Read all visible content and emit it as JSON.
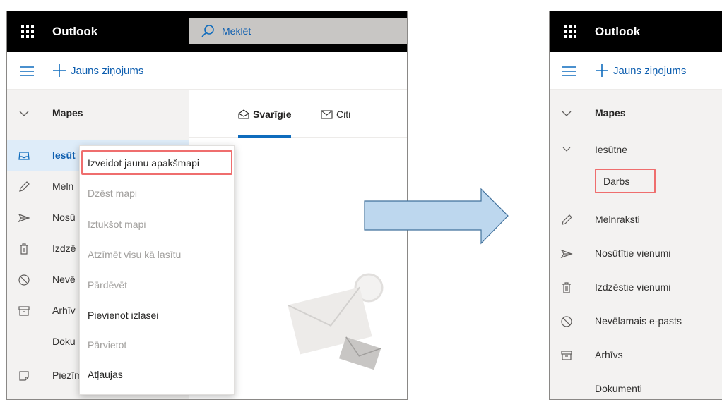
{
  "left": {
    "app_title": "Outlook",
    "search_placeholder": "Meklēt",
    "new_message": "Jauns ziņojums",
    "folders_header": "Mapes",
    "folders": [
      "Iesūt",
      "Meln",
      "Nosū",
      "Izdzē",
      "Nevē",
      "Arhīv",
      "Doku",
      "Piezīmes"
    ],
    "tabs": {
      "focused": "Svarīgie",
      "other": "Citi"
    },
    "context_menu": [
      {
        "label": "Izveidot jaunu apakšmapi",
        "enabled": true
      },
      {
        "label": "Dzēst mapi",
        "enabled": false
      },
      {
        "label": "Iztukšot mapi",
        "enabled": false
      },
      {
        "label": "Atzīmēt visu kā lasītu",
        "enabled": false
      },
      {
        "label": "Pārdēvēt",
        "enabled": false
      },
      {
        "label": "Pievienot izlasei",
        "enabled": true
      },
      {
        "label": "Pārvietot",
        "enabled": false
      },
      {
        "label": "Atļaujas",
        "enabled": true
      }
    ]
  },
  "right": {
    "app_title": "Outlook",
    "new_message": "Jauns ziņojums",
    "folders_header": "Mapes",
    "inbox": "Iesūtne",
    "subfolder": "Darbs",
    "folders": [
      "Melnraksti",
      "Nosūtītie vienumi",
      "Izdzēstie vienumi",
      "Nevēlamais e-pasts",
      "Arhīvs",
      "Dokumenti"
    ]
  },
  "colors": {
    "accent": "#0f6cbd",
    "highlight": "#ef6e6e",
    "selected_bg": "#deecf9",
    "arrow_fill": "#bdd7ee",
    "arrow_stroke": "#41719c"
  },
  "icons": [
    "app-launcher-icon",
    "search-icon",
    "hamburger-icon",
    "plus-icon",
    "chevron-down-icon",
    "inbox-icon",
    "pencil-icon",
    "send-icon",
    "trash-icon",
    "block-icon",
    "archive-icon",
    "note-icon",
    "focused-icon",
    "other-mail-icon"
  ]
}
